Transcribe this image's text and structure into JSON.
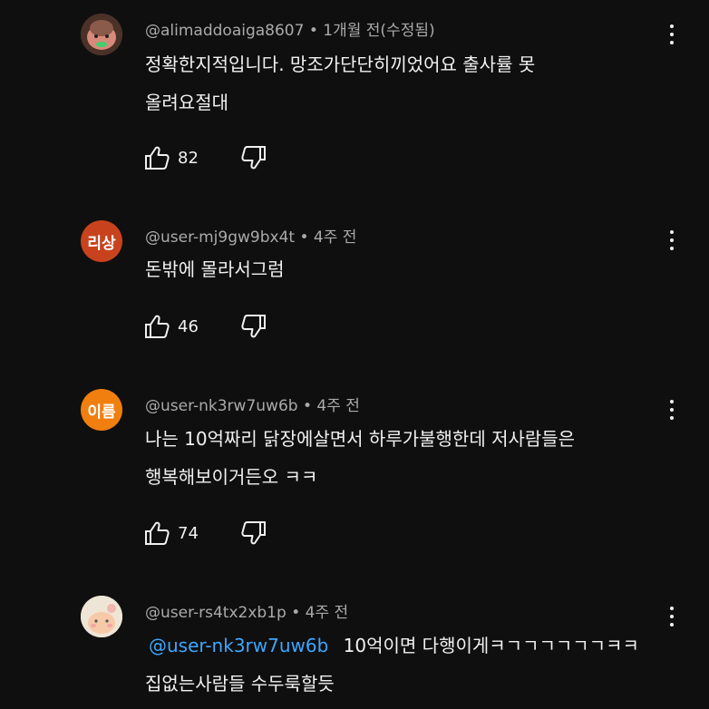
{
  "comments": [
    {
      "author": "@alimaddoaiga8607",
      "time": "1개월 전(수정됨)",
      "separator": "•",
      "avatar_color": "#6b4a3a",
      "line1": "정확한지적입니다. 망조가단단히끼었어요 출사률 못",
      "line2": "올려요절대",
      "likes": "82"
    },
    {
      "author": "@user-mj9gw9bx4t",
      "time": "4주 전",
      "separator": "•",
      "avatar_text": "리상",
      "avatar_color": "#c8431d",
      "line1": "돈밖에 몰라서그럼",
      "likes": "46"
    },
    {
      "author": "@user-nk3rw7uw6b",
      "time": "4주 전",
      "separator": "•",
      "avatar_text": "이름",
      "avatar_color": "#f07f0f",
      "line1": "나는 10억짜리 닭장에살면서 하루가불행한데 저사람들은",
      "line2": "행복해보이거든오 ㅋㅋ",
      "likes": "74"
    },
    {
      "author": "@user-rs4tx2xb1p",
      "time": "4주 전",
      "separator": "•",
      "avatar_color": "#e9dcc8",
      "mention": "@user-nk3rw7uw6b",
      "line1": "10억이면 다행이게ㅋㄱㄱㄱㄱㄱㄱㅋㅋ",
      "line2": "집없는사람들 수두룩할듯"
    }
  ]
}
